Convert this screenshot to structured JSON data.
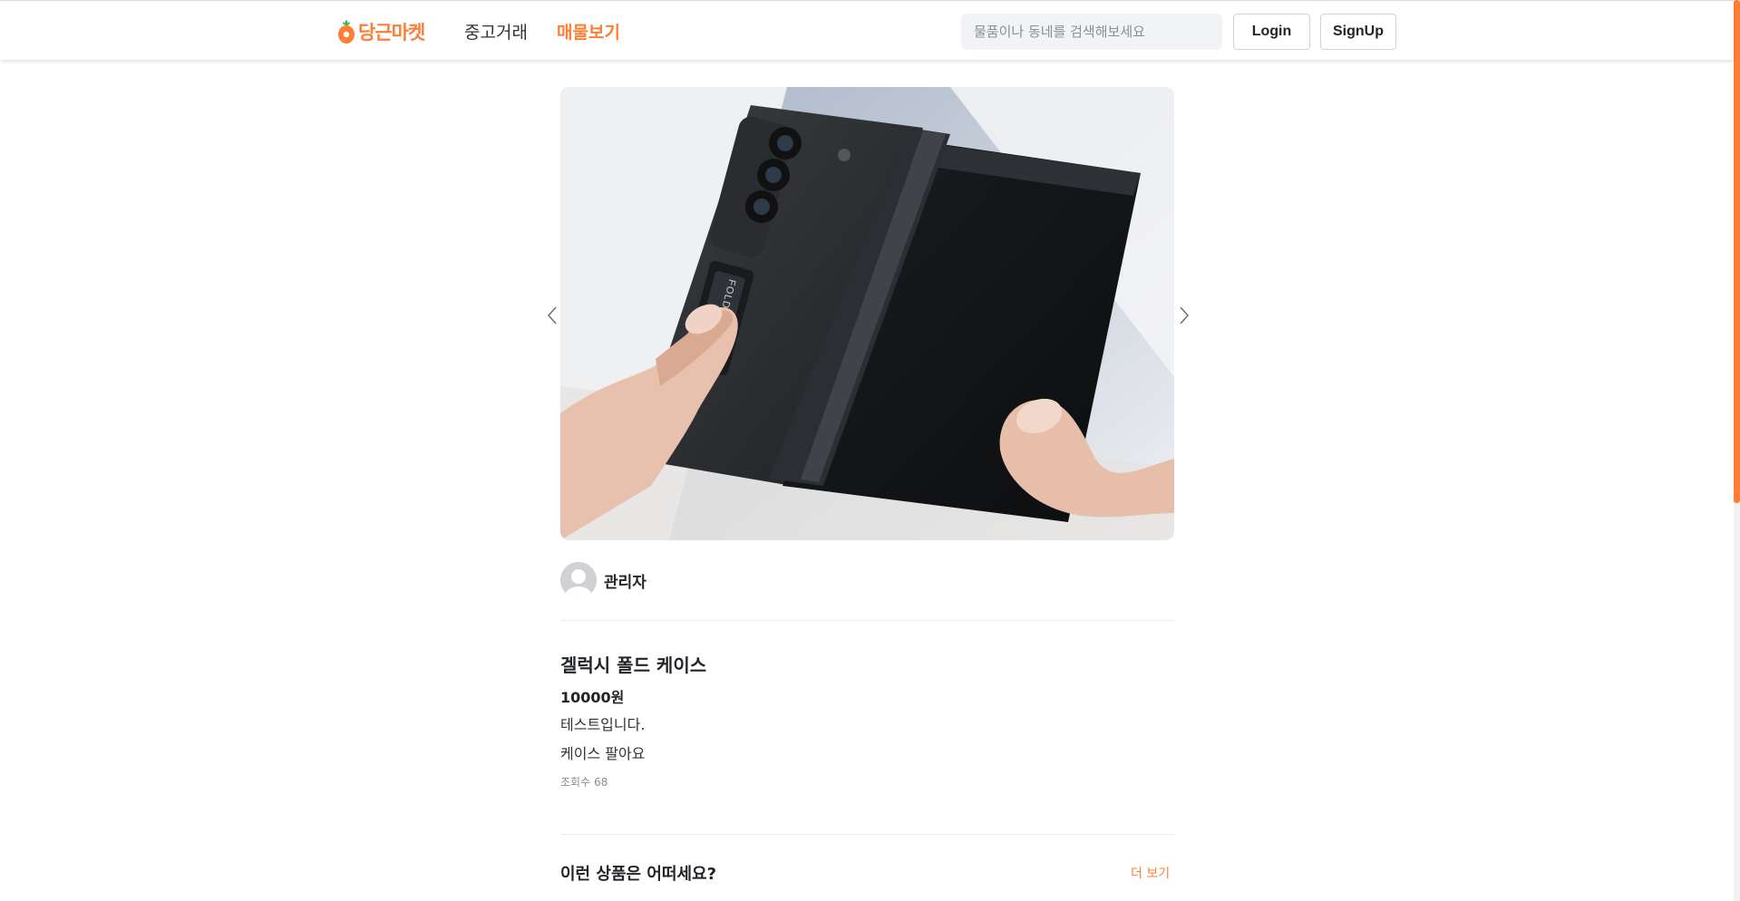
{
  "header": {
    "logo_text": "당근마켓",
    "nav": {
      "trade_label": "중고거래",
      "listing_label": "매물보기"
    },
    "search": {
      "placeholder": "물품이나 동네를 검색해보세요",
      "value": ""
    },
    "login_label": "Login",
    "signup_label": "SignUp"
  },
  "product": {
    "seller_name": "관리자",
    "title": "겔럭시 폴드 케이스",
    "price": "10000원",
    "description_lines": [
      "테스트입니다.",
      "케이스 팔아요"
    ],
    "views_label": "조회수",
    "views_count": "68",
    "image_print": "FOLDING SUPPORT"
  },
  "recommendations": {
    "title": "이런 상품은 어떠세요?",
    "more_label": "더 보기"
  },
  "colors": {
    "brand": "#ff7e36",
    "text": "#212529",
    "muted": "#868e96"
  },
  "icons": {
    "prev": "chevron-left-icon",
    "next": "chevron-right-icon",
    "avatar": "user-avatar-icon",
    "logo": "carrot-icon"
  }
}
